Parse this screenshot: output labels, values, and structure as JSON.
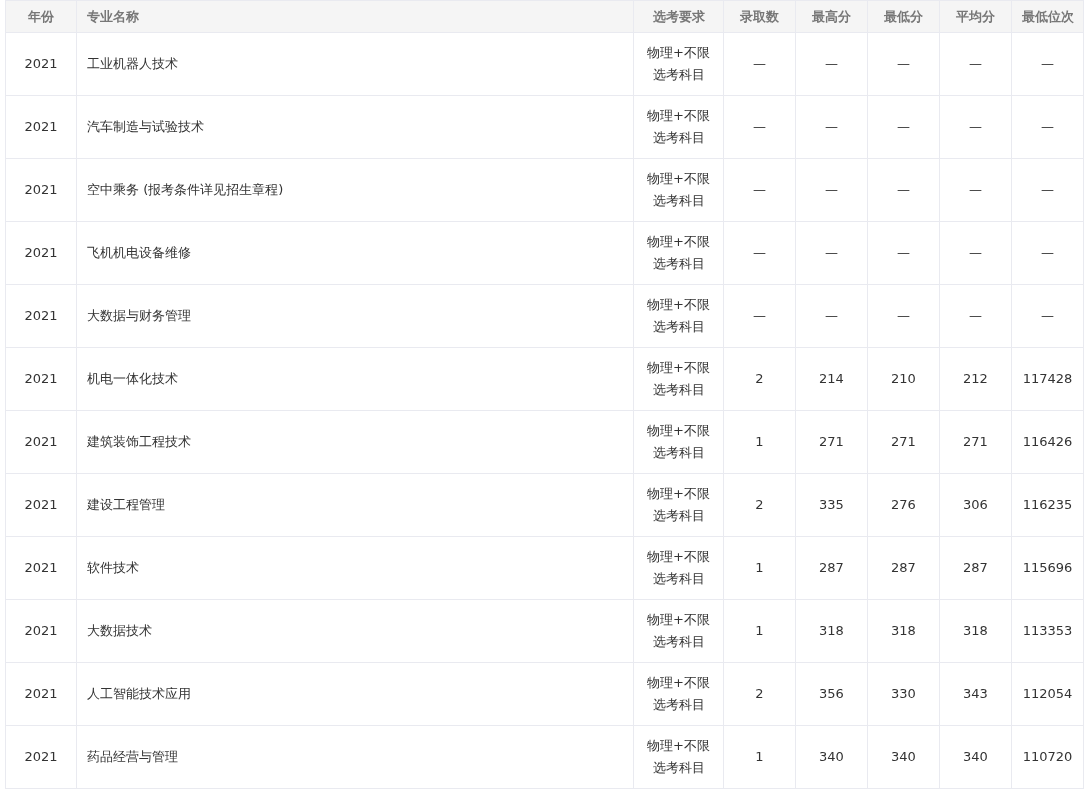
{
  "table": {
    "columns": [
      "年份",
      "专业名称",
      "选考要求",
      "录取数",
      "最高分",
      "最低分",
      "平均分",
      "最低位次"
    ],
    "rows": [
      [
        "2021",
        "工业机器人技术",
        "物理+不限选考科目",
        "—",
        "—",
        "—",
        "—",
        "—"
      ],
      [
        "2021",
        "汽车制造与试验技术",
        "物理+不限选考科目",
        "—",
        "—",
        "—",
        "—",
        "—"
      ],
      [
        "2021",
        "空中乘务 (报考条件详见招生章程)",
        "物理+不限选考科目",
        "—",
        "—",
        "—",
        "—",
        "—"
      ],
      [
        "2021",
        "飞机机电设备维修",
        "物理+不限选考科目",
        "—",
        "—",
        "—",
        "—",
        "—"
      ],
      [
        "2021",
        "大数据与财务管理",
        "物理+不限选考科目",
        "—",
        "—",
        "—",
        "—",
        "—"
      ],
      [
        "2021",
        "机电一体化技术",
        "物理+不限选考科目",
        "2",
        "214",
        "210",
        "212",
        "117428"
      ],
      [
        "2021",
        "建筑装饰工程技术",
        "物理+不限选考科目",
        "1",
        "271",
        "271",
        "271",
        "116426"
      ],
      [
        "2021",
        "建设工程管理",
        "物理+不限选考科目",
        "2",
        "335",
        "276",
        "306",
        "116235"
      ],
      [
        "2021",
        "软件技术",
        "物理+不限选考科目",
        "1",
        "287",
        "287",
        "287",
        "115696"
      ],
      [
        "2021",
        "大数据技术",
        "物理+不限选考科目",
        "1",
        "318",
        "318",
        "318",
        "113353"
      ],
      [
        "2021",
        "人工智能技术应用",
        "物理+不限选考科目",
        "2",
        "356",
        "330",
        "343",
        "112054"
      ],
      [
        "2021",
        "药品经营与管理",
        "物理+不限选考科目",
        "1",
        "340",
        "340",
        "340",
        "110720"
      ]
    ]
  }
}
